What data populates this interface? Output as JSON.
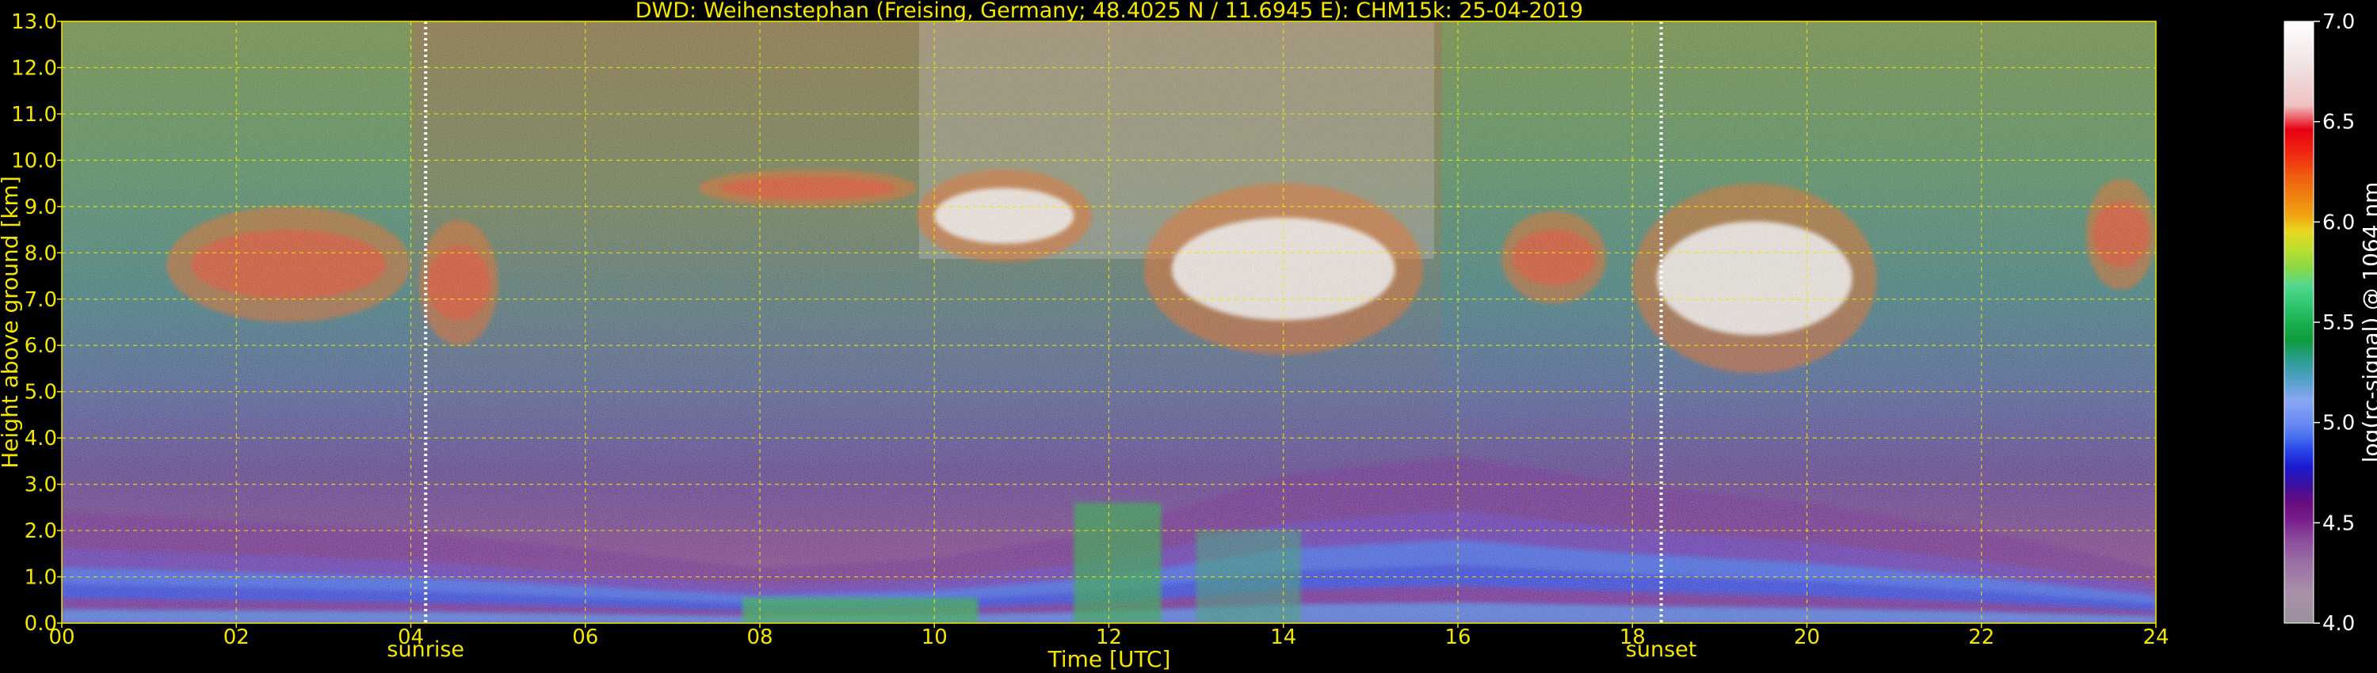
{
  "chart_data": {
    "type": "heatmap",
    "title": "DWD: Weihenstephan (Freising, Germany; 48.4025 N / 11.6945 E):    CHM15k: 25-04-2019",
    "xlabel": "Time [UTC]",
    "ylabel": "Height above ground [km]",
    "xlim": [
      0,
      24
    ],
    "ylim": [
      0,
      13
    ],
    "x_ticks": [
      "00",
      "02",
      "04",
      "06",
      "08",
      "10",
      "12",
      "14",
      "16",
      "18",
      "20",
      "22",
      "24"
    ],
    "y_ticks": [
      "0.0",
      "1.0",
      "2.0",
      "3.0",
      "4.0",
      "5.0",
      "6.0",
      "7.0",
      "8.0",
      "9.0",
      "10.0",
      "11.0",
      "12.0",
      "13.0"
    ],
    "grid": true,
    "colorbar": {
      "label": "log(rc-signal) @ 1064 nm",
      "range": [
        4.0,
        7.0
      ],
      "ticks": [
        "4.0",
        "4.5",
        "5.0",
        "5.5",
        "6.0",
        "6.5",
        "7.0"
      ],
      "colors": [
        "#9a8f9c",
        "#a991a9",
        "#9a6fa5",
        "#8a4a9c",
        "#7a1f8c",
        "#6a0c7e",
        "#3a10a0",
        "#1a1ad0",
        "#2a4ae8",
        "#4a70f0",
        "#6a8cf2",
        "#8aa6f4",
        "#4aa0c0",
        "#2a9e8a",
        "#0e9a3a",
        "#1ab050",
        "#30c870",
        "#50d890",
        "#8ad848",
        "#b8e030",
        "#e8d820",
        "#f0a010",
        "#f08010",
        "#f06010",
        "#f02a10",
        "#e60010",
        "#f0c0c0",
        "#f0e0e0",
        "#ffffff"
      ]
    },
    "events": [
      {
        "name": "sunrise",
        "x": 4.17
      },
      {
        "name": "sunset",
        "x": 18.33
      }
    ],
    "features": {
      "boundary_layer_top_km": [
        1.2,
        1.1,
        1.0,
        0.8,
        0.6,
        0.7,
        1.0,
        1.6,
        1.8,
        1.5,
        1.3,
        1.0,
        0.6
      ],
      "cirrus_clouds": [
        {
          "t": [
            1.2,
            4.0
          ],
          "base_km": 6.5,
          "top_km": 9.0
        },
        {
          "t": [
            4.1,
            5.0
          ],
          "base_km": 6.0,
          "top_km": 8.7
        },
        {
          "t": [
            7.3,
            9.8
          ],
          "base_km": 9.0,
          "top_km": 9.8
        },
        {
          "t": [
            9.8,
            11.8
          ],
          "base_km": 7.8,
          "top_km": 9.8
        },
        {
          "t": [
            12.4,
            15.6
          ],
          "base_km": 5.8,
          "top_km": 9.5
        },
        {
          "t": [
            16.5,
            17.7
          ],
          "base_km": 6.9,
          "top_km": 8.9
        },
        {
          "t": [
            18.0,
            20.8
          ],
          "base_km": 5.4,
          "top_km": 9.5
        },
        {
          "t": [
            23.2,
            24.0
          ],
          "base_km": 7.2,
          "top_km": 9.6
        }
      ]
    }
  }
}
